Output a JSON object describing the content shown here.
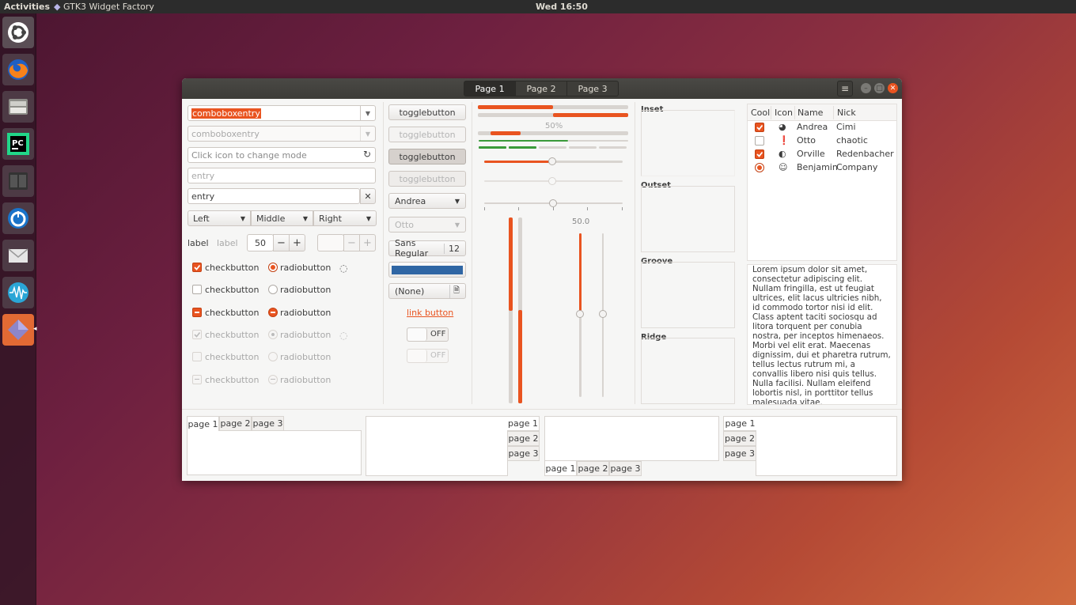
{
  "topbar": {
    "activities": "Activities",
    "app": "GTK3 Widget Factory",
    "clock": "Wed 16:50"
  },
  "dock": [
    "ubuntu-icon",
    "firefox-icon",
    "files-icon",
    "pycharm-icon",
    "terminal-icon",
    "timer-icon",
    "mail-icon",
    "audio-icon",
    "gtk-widget-factory-icon"
  ],
  "header": {
    "tabs": [
      "Page 1",
      "Page 2",
      "Page 3"
    ]
  },
  "entries": {
    "combo_entry": "comboboxentry",
    "combo_entry_disabled": "comboboxentry",
    "mode_entry_placeholder": "Click icon to change mode",
    "entry_placeholder": "entry",
    "entry_clear": "entry"
  },
  "linked": [
    "Left",
    "Middle",
    "Right"
  ],
  "spin": {
    "label1": "label",
    "label2": "label",
    "value": "50"
  },
  "checks": [
    {
      "label": "checkbutton",
      "state": "checked"
    },
    {
      "label": "checkbutton",
      "state": "unchecked"
    },
    {
      "label": "checkbutton",
      "state": "mixed"
    },
    {
      "label": "checkbutton",
      "state": "checked-disabled"
    },
    {
      "label": "checkbutton",
      "state": "unchecked-disabled"
    },
    {
      "label": "checkbutton",
      "state": "mixed-disabled"
    }
  ],
  "radios": [
    {
      "label": "radiobutton",
      "state": "checked"
    },
    {
      "label": "radiobutton",
      "state": "unchecked"
    },
    {
      "label": "radiobutton",
      "state": "mixed"
    },
    {
      "label": "radiobutton",
      "state": "checked-disabled"
    },
    {
      "label": "radiobutton",
      "state": "unchecked-disabled"
    },
    {
      "label": "radiobutton",
      "state": "mixed-disabled"
    }
  ],
  "col2": {
    "toggles": [
      "togglebutton",
      "togglebutton",
      "togglebutton",
      "togglebutton"
    ],
    "combo1": "Andrea",
    "combo2": "Otto",
    "font": {
      "name": "Sans Regular",
      "size": "12"
    },
    "color": "#2f66a4",
    "file": "(None)",
    "link": "link button",
    "switch1": "OFF",
    "switch2": "OFF"
  },
  "col3": {
    "progress_text": "50%",
    "scale_value": "50.0",
    "progress1": 0.5,
    "progress2": 0.5,
    "level": 0.5
  },
  "frames": [
    "Inset",
    "Outset",
    "Groove",
    "Ridge"
  ],
  "tree": {
    "headers": [
      "Cool",
      "Icon",
      "Name",
      "Nick"
    ],
    "rows": [
      {
        "cool": "checked",
        "icon": "emblem-icon",
        "name": "Andrea",
        "nick": "Cimi"
      },
      {
        "cool": "unchecked",
        "icon": "dialog-warning-icon",
        "name": "Otto",
        "nick": "chaotic"
      },
      {
        "cool": "checked",
        "icon": "weather-clear-night-icon",
        "name": "Orville",
        "nick": "Redenbacher"
      },
      {
        "cool": "radio",
        "icon": "face-icon",
        "name": "Benjamin",
        "nick": "Company"
      }
    ]
  },
  "textview": "Lorem ipsum dolor sit amet, consectetur adipiscing elit.\nNullam fringilla, est ut feugiat ultrices, elit lacus ultricies nibh, id commodo tortor nisi id elit.\nClass aptent taciti sociosqu ad litora torquent per conubia nostra, per inceptos himenaeos.\nMorbi vel elit erat. Maecenas dignissim, dui et pharetra rutrum, tellus lectus rutrum mi, a convallis libero nisi quis tellus.\nNulla facilisi. Nullam eleifend lobortis nisl, in porttitor tellus malesuada vitae.",
  "notebook_tabs": [
    "page 1",
    "page 2",
    "page 3"
  ]
}
